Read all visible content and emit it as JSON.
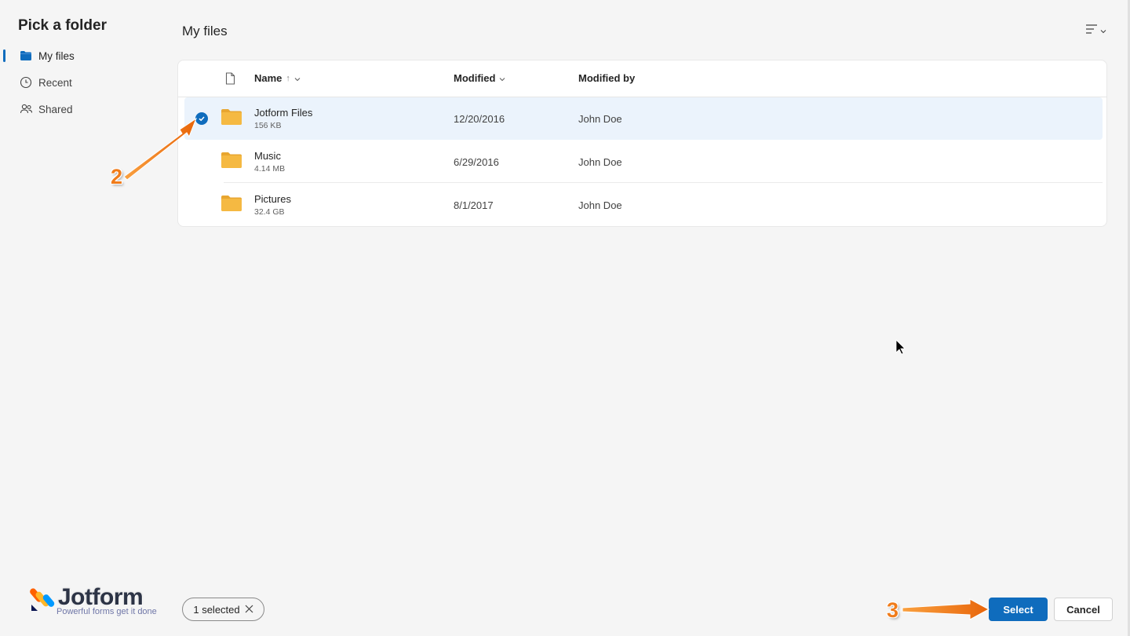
{
  "sidebar": {
    "title": "Pick a folder",
    "items": [
      {
        "label": "My files",
        "icon": "folder-icon",
        "active": true
      },
      {
        "label": "Recent",
        "icon": "clock-icon",
        "active": false
      },
      {
        "label": "Shared",
        "icon": "people-icon",
        "active": false
      }
    ]
  },
  "main": {
    "title": "My files",
    "columns": {
      "name": "Name",
      "modified": "Modified",
      "modified_by": "Modified by"
    },
    "files": [
      {
        "name": "Jotform Files",
        "size": "156 KB",
        "modified": "12/20/2016",
        "modified_by": "John Doe",
        "selected": true
      },
      {
        "name": "Music",
        "size": "4.14 MB",
        "modified": "6/29/2016",
        "modified_by": "John Doe",
        "selected": false
      },
      {
        "name": "Pictures",
        "size": "32.4 GB",
        "modified": "8/1/2017",
        "modified_by": "John Doe",
        "selected": false
      }
    ]
  },
  "footer": {
    "selected_label": "1 selected",
    "select_button": "Select",
    "cancel_button": "Cancel",
    "logo_word": "Jotform",
    "logo_tagline": "Powerful forms get it done"
  },
  "annotations": {
    "step2": "2",
    "step3": "3"
  },
  "colors": {
    "accent": "#0f6cbd",
    "folder": "#f5b942",
    "annotation": "#f07c1b",
    "selected_row": "#ebf3fc"
  }
}
